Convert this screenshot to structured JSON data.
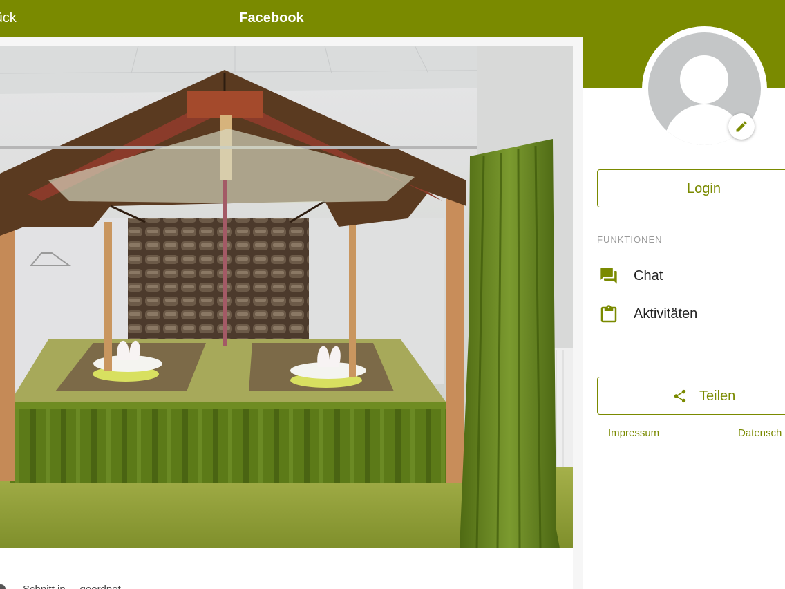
{
  "topbar": {
    "back_label": "rück",
    "title": "Facebook"
  },
  "post": {
    "image_alt": "Massageraum mit Holzbaldachin und grünem Vorhang",
    "caption": "Schnitt in ... geordnet"
  },
  "profile": {
    "avatar_icon": "default-user-icon",
    "edit_icon": "pencil-icon"
  },
  "sidebar": {
    "login_label": "Login",
    "section_label": "FUNKTIONEN",
    "menu": [
      {
        "label": "Chat",
        "icon": "chat-icon"
      },
      {
        "label": "Aktivitäten",
        "icon": "clipboard-icon"
      }
    ],
    "share_label": "Teilen",
    "footer": {
      "impressum": "Impressum",
      "datenschutz": "Datensch"
    }
  },
  "colors": {
    "accent": "#7a8a00",
    "curtain": "#5f7a1c",
    "avatar_grey": "#c4c6c7"
  }
}
